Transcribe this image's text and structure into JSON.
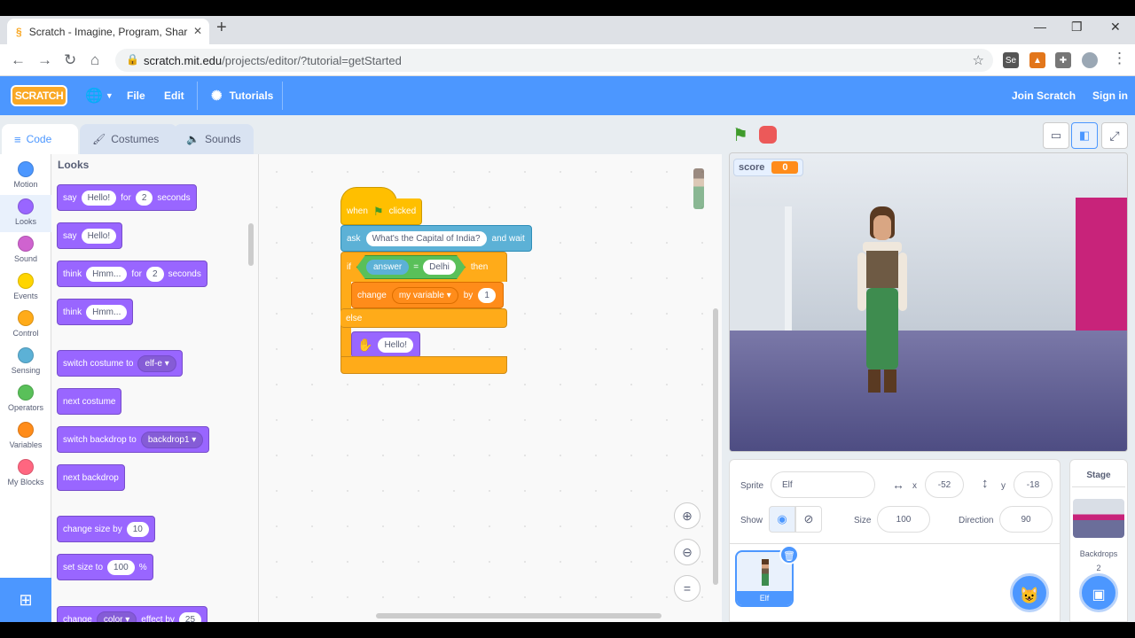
{
  "browser": {
    "tab_title": "Scratch - Imagine, Program, Shar",
    "new_tab": "+",
    "url_host": "scratch.mit.edu",
    "url_path": "/projects/editor/?tutorial=getStarted",
    "win_min": "—",
    "win_max": "❐",
    "win_close": "✕"
  },
  "menu": {
    "logo": "SCRATCH",
    "globe": "🌐",
    "file": "File",
    "edit": "Edit",
    "tutorials": "Tutorials",
    "join": "Join Scratch",
    "signin": "Sign in"
  },
  "tabs": {
    "code": "Code",
    "costumes": "Costumes",
    "sounds": "Sounds"
  },
  "categories": [
    {
      "label": "Motion",
      "color": "#4c97ff"
    },
    {
      "label": "Looks",
      "color": "#9966ff"
    },
    {
      "label": "Sound",
      "color": "#cf63cf"
    },
    {
      "label": "Events",
      "color": "#ffd500"
    },
    {
      "label": "Control",
      "color": "#ffab19"
    },
    {
      "label": "Sensing",
      "color": "#5cb1d6"
    },
    {
      "label": "Operators",
      "color": "#59c059"
    },
    {
      "label": "Variables",
      "color": "#ff8c1a"
    },
    {
      "label": "My Blocks",
      "color": "#ff6680"
    }
  ],
  "palette": {
    "heading": "Looks",
    "b1": {
      "a": "say",
      "v": "Hello!",
      "b": "for",
      "n": "2",
      "c": "seconds"
    },
    "b2": {
      "a": "say",
      "v": "Hello!"
    },
    "b3": {
      "a": "think",
      "v": "Hmm...",
      "b": "for",
      "n": "2",
      "c": "seconds"
    },
    "b4": {
      "a": "think",
      "v": "Hmm..."
    },
    "b5": {
      "a": "switch costume to",
      "v": "elf-e ▾"
    },
    "b6": {
      "a": "next costume"
    },
    "b7": {
      "a": "switch backdrop to",
      "v": "backdrop1 ▾"
    },
    "b8": {
      "a": "next backdrop"
    },
    "b9": {
      "a": "change size by",
      "v": "10"
    },
    "b10": {
      "a": "set size to",
      "v": "100",
      "b": "%"
    },
    "b11": {
      "a": "change",
      "v": "color ▾",
      "b": "effect by",
      "n": "25"
    }
  },
  "script": {
    "when": "when",
    "clicked": "clicked",
    "ask": "ask",
    "question": "What's the Capital of India?",
    "andwait": "and wait",
    "if": "if",
    "answer": "answer",
    "eq": "=",
    "delhi": "Delhi",
    "then": "then",
    "change": "change",
    "myvar": "my variable ▾",
    "by": "by",
    "one": "1",
    "else": "else",
    "hello": "Hello!"
  },
  "stage": {
    "var_name": "score",
    "var_value": "0"
  },
  "sprite": {
    "sprite_lbl": "Sprite",
    "name": "Elf",
    "x_lbl": "x",
    "x": "-52",
    "y_lbl": "y",
    "y": "-18",
    "show_lbl": "Show",
    "size_lbl": "Size",
    "size": "100",
    "dir_lbl": "Direction",
    "dir": "90",
    "thumb_name": "Elf"
  },
  "stage_pane": {
    "title": "Stage",
    "backdrops_lbl": "Backdrops",
    "backdrops": "2"
  },
  "colors": {
    "blue": "#4c97ff",
    "looks": "#9966ff",
    "events": "#ffbf00",
    "sensing": "#5cb1d6",
    "control": "#ffab19",
    "operators": "#59c059",
    "variables": "#ff8c1a"
  }
}
